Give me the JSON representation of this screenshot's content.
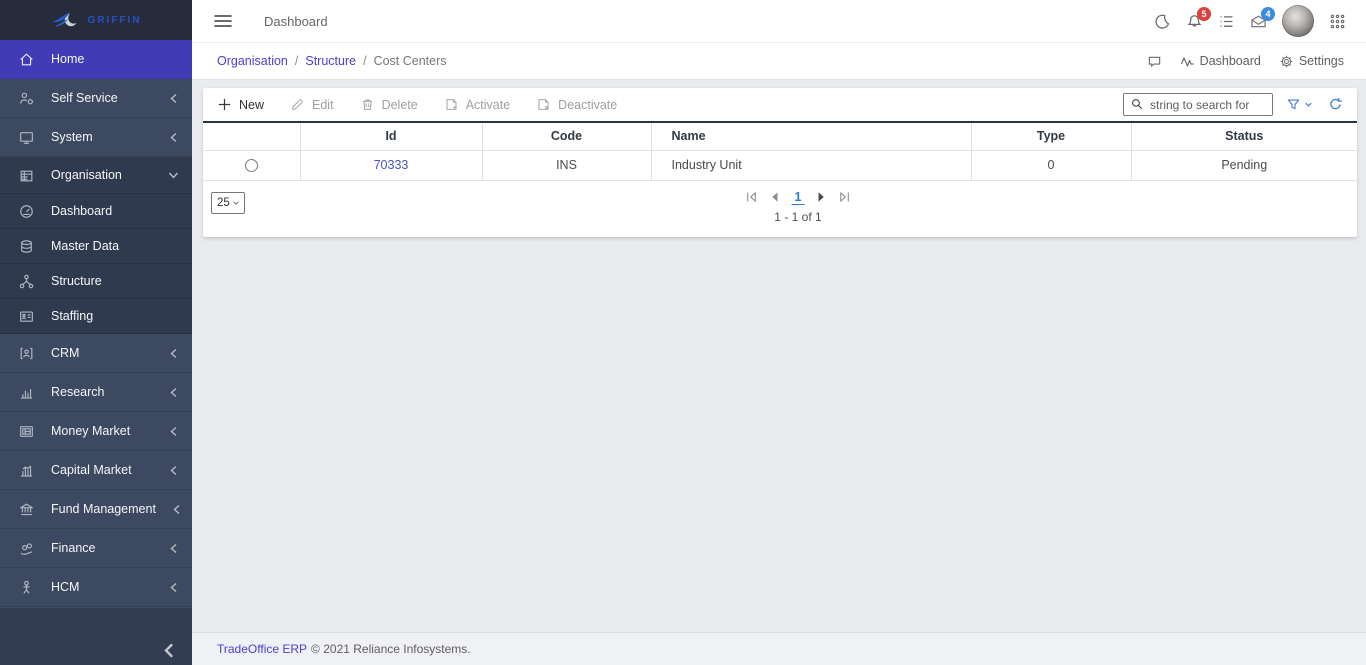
{
  "colors": {
    "sidebar_bg": "#3d4961",
    "sidebar_group_bg": "#303a4e",
    "sidebar_logo_bg": "#262c3c",
    "active_item_purple": "#413cb5",
    "link_purple": "#4b40d2",
    "table_id_link_blue": "#4853c6",
    "pager_active_blue": "#2b7cd3",
    "badge_red": "#d9443f",
    "badge_blue": "#3d8be0",
    "toolbar_icon_blue": "#3f7fd6",
    "content_bg": "#e9ebee",
    "table_top_border": "#2b3446"
  },
  "sidebar": {
    "logo_text": "GRIFFIN",
    "items": [
      {
        "label": "Home",
        "icon": "home-icon",
        "active": true
      },
      {
        "label": "Self Service",
        "icon": "self-service-icon",
        "chevron": "left"
      },
      {
        "label": "System",
        "icon": "system-icon",
        "chevron": "left"
      },
      {
        "label": "Organisation",
        "icon": "organisation-icon",
        "chevron": "down",
        "expanded": true
      },
      {
        "label": "Dashboard",
        "icon": "dashboard-icon",
        "child": true
      },
      {
        "label": "Master Data",
        "icon": "master-data-icon",
        "child": true
      },
      {
        "label": "Structure",
        "icon": "structure-icon",
        "child": true
      },
      {
        "label": "Staffing",
        "icon": "staffing-icon",
        "child": true
      },
      {
        "label": "CRM",
        "icon": "crm-icon",
        "chevron": "left"
      },
      {
        "label": "Research",
        "icon": "research-icon",
        "chevron": "left"
      },
      {
        "label": "Money Market",
        "icon": "money-market-icon",
        "chevron": "left"
      },
      {
        "label": "Capital Market",
        "icon": "capital-market-icon",
        "chevron": "left"
      },
      {
        "label": "Fund Management",
        "icon": "fund-management-icon",
        "chevron": "left"
      },
      {
        "label": "Finance",
        "icon": "finance-icon",
        "chevron": "left"
      },
      {
        "label": "HCM",
        "icon": "hcm-icon",
        "chevron": "left"
      }
    ]
  },
  "topbar": {
    "title": "Dashboard",
    "notifications_count": "5",
    "messages_count": "4"
  },
  "breadcrumb": {
    "items": [
      "Organisation",
      "Structure",
      "Cost Centers"
    ],
    "separator": "/",
    "actions": {
      "dashboard_label": "Dashboard",
      "settings_label": "Settings"
    }
  },
  "toolbar": {
    "new_label": "New",
    "edit_label": "Edit",
    "delete_label": "Delete",
    "activate_label": "Activate",
    "deactivate_label": "Deactivate",
    "search_placeholder": "string to search for"
  },
  "table": {
    "headers": [
      "",
      "Id",
      "Code",
      "Name",
      "Type",
      "Status"
    ],
    "rows": [
      {
        "id": "70333",
        "code": "INS",
        "name": "Industry Unit",
        "type": "0",
        "status": "Pending"
      }
    ]
  },
  "pagination": {
    "page_size": "25",
    "current_page": "1",
    "summary": "1 - 1 of 1"
  },
  "footer": {
    "link_text": "TradeOffice ERP",
    "copyright": "© 2021 Reliance Infosystems."
  }
}
